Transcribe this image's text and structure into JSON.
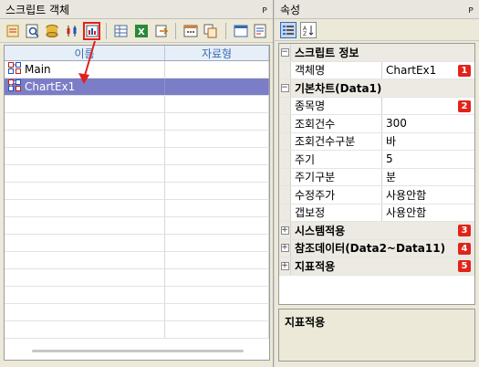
{
  "left_panel": {
    "title": "스크립트 객체",
    "pin": "ᵖ",
    "toolbar_icons": [
      "script-edit-icon",
      "search-doc-icon",
      "db-icon",
      "candle-chart-icon",
      "chart-script-icon",
      "grid-icon",
      "excel-icon",
      "export-icon",
      "calendar-icon",
      "copy-icon",
      "window-icon",
      "settings-doc-icon"
    ],
    "columns": [
      "이름",
      "자료형"
    ],
    "rows": [
      {
        "name": "Main",
        "type": ""
      },
      {
        "name": "ChartEx1",
        "type": ""
      }
    ]
  },
  "right_panel": {
    "title": "속성",
    "pin": "ᵖ",
    "sections": [
      {
        "label": "스크립트 정보",
        "expanded": true,
        "items": [
          {
            "key": "객체명",
            "value": "ChartEx1",
            "badge": "1"
          }
        ]
      },
      {
        "label": "기본차트(Data1)",
        "expanded": true,
        "items": [
          {
            "key": "종목명",
            "value": "",
            "badge": "2"
          },
          {
            "key": "조회건수",
            "value": "300"
          },
          {
            "key": "조회건수구분",
            "value": "바"
          },
          {
            "key": "주기",
            "value": "5"
          },
          {
            "key": "주기구분",
            "value": "분"
          },
          {
            "key": "수정주가",
            "value": "사용안함"
          },
          {
            "key": "갭보정",
            "value": "사용안함"
          }
        ]
      },
      {
        "label": "시스템적용",
        "expanded": false,
        "badge": "3"
      },
      {
        "label": "참조데이터(Data2~Data11)",
        "expanded": false,
        "badge": "4"
      },
      {
        "label": "지표적용",
        "expanded": false,
        "badge": "5"
      }
    ],
    "description_title": "지표적용"
  },
  "colors": {
    "selection": "#7b7dc6",
    "badge": "#e0241a",
    "header_text": "#3a6fb0",
    "arrow": "#e02020"
  }
}
